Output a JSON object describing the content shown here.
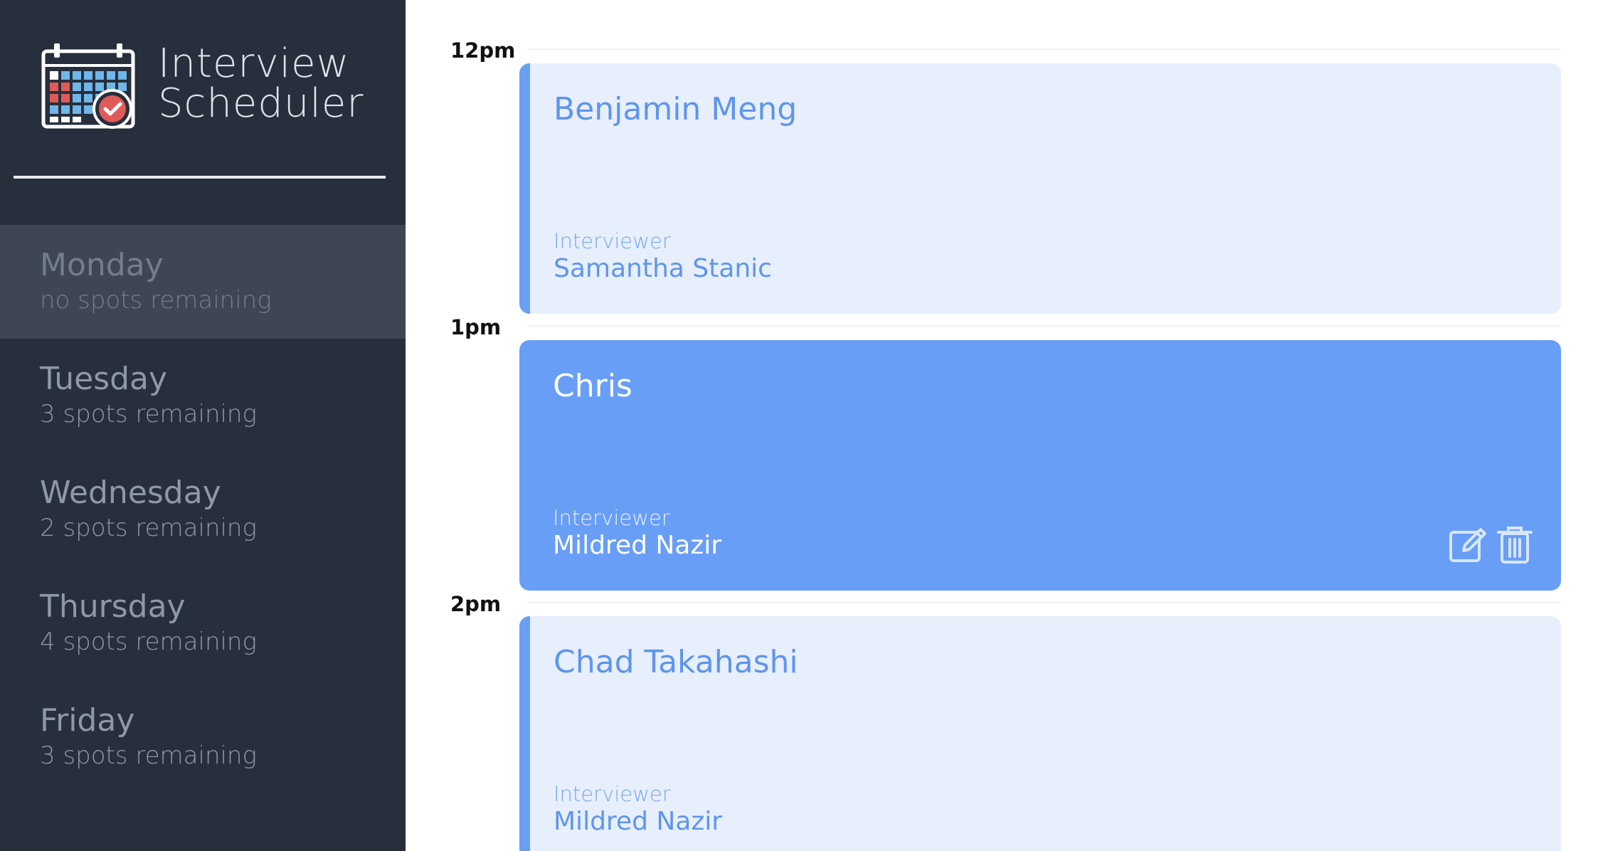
{
  "brand": {
    "line1": "Interview",
    "line2": "Scheduler"
  },
  "days": [
    {
      "name": "Monday",
      "spots": "no spots remaining",
      "selected": true
    },
    {
      "name": "Tuesday",
      "spots": "3 spots remaining"
    },
    {
      "name": "Wednesday",
      "spots": "2 spots remaining"
    },
    {
      "name": "Thursday",
      "spots": "4 spots remaining"
    },
    {
      "name": "Friday",
      "spots": "3 spots remaining"
    }
  ],
  "schedule": {
    "slots": [
      {
        "time": "12pm",
        "student": "Benjamin Meng",
        "interviewer_label": "Interviewer",
        "interviewer": "Samantha Stanic"
      },
      {
        "time": "1pm",
        "student": "Chris",
        "interviewer_label": "Interviewer",
        "interviewer": "Mildred Nazir",
        "active": true
      },
      {
        "time": "2pm",
        "student": "Chad Takahashi",
        "interviewer_label": "Interviewer",
        "interviewer": "Mildred Nazir"
      }
    ]
  },
  "icons": {
    "logo": "calendar-check-icon",
    "edit": "edit-icon",
    "delete": "trash-icon"
  },
  "colors": {
    "sidebar": "#272f3d",
    "selected_day": "#3e4653",
    "appointment_light": "#e7effd",
    "appointment_active": "#689ef6",
    "accent": "#6a9ff2"
  }
}
